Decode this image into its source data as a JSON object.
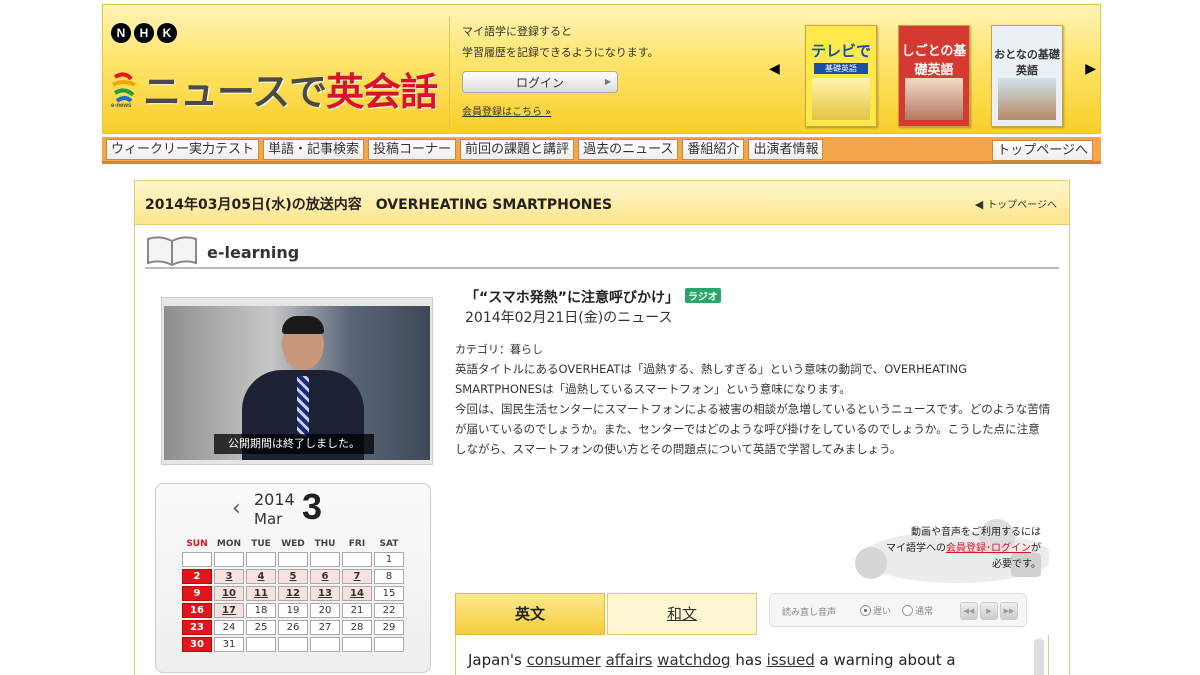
{
  "header": {
    "nhk_letters": [
      "N",
      "H",
      "K"
    ],
    "enews_caption": "e-news",
    "title_part1": "ニュースで",
    "title_part2": "英会話",
    "login_message_line1": "マイ語学に登録すると",
    "login_message_line2": "学習履歴を記録できるようになります。",
    "login_label": "ログイン",
    "register_label": "会員登録はこちら",
    "books": [
      {
        "title": "テレビで",
        "subtitle": "基礎英語",
        "color": "#ffe94a"
      },
      {
        "title": "しごとの基礎英語",
        "subtitle": "",
        "color": "#d43a32"
      },
      {
        "title": "おとなの基礎英語",
        "subtitle": "",
        "color": "#eaf0f4"
      }
    ]
  },
  "nav": {
    "items": [
      "ウィークリー実力テスト",
      "単語・記事検索",
      "投稿コーナー",
      "前回の課題と講評",
      "過去のニュース",
      "番組紹介",
      "出演者情報"
    ],
    "top_page": "トップページへ"
  },
  "broadcast": {
    "title": "2014年03月05日(水)の放送内容　OVERHEATING SMARTPHONES",
    "to_top": "トップページへ"
  },
  "elearning": {
    "label": "e-learning"
  },
  "video": {
    "caption": "公開期間は終了しました。"
  },
  "calendar": {
    "year": "2014",
    "month_name": "Mar",
    "month_num": "3",
    "weekdays": [
      "SUN",
      "MON",
      "TUE",
      "WED",
      "THU",
      "FRI",
      "SAT"
    ],
    "weeks": [
      [
        "",
        "",
        "",
        "",
        "",
        "",
        "1"
      ],
      [
        "2",
        "3",
        "4",
        "5",
        "6",
        "7",
        "8"
      ],
      [
        "9",
        "10",
        "11",
        "12",
        "13",
        "14",
        "15"
      ],
      [
        "16",
        "17",
        "18",
        "19",
        "20",
        "21",
        "22"
      ],
      [
        "23",
        "24",
        "25",
        "26",
        "27",
        "28",
        "29"
      ],
      [
        "30",
        "31",
        "",
        "",
        "",
        "",
        ""
      ]
    ],
    "available_days": [
      "3",
      "4",
      "5",
      "6",
      "7",
      "10",
      "11",
      "12",
      "13",
      "14",
      "17"
    ]
  },
  "article": {
    "title": "“スマホ発熱”に注意呼びかけ」",
    "badge": "ラジオ",
    "date": "2014年02月21日(金)のニュース",
    "category": "カテゴリ：暮らし",
    "body_paragraph1": "英語タイトルにあるOVERHEATは「過熱する、熱しすぎる」という意味の動詞で、OVERHEATING SMARTPHONESは「過熱しているスマートフォン」という意味になります。",
    "body_paragraph2": "今回は、国民生活センターにスマートフォンによる被害の相談が急増しているというニュースです。どのような苦情が届いているのでしょうか。また、センターではどのような呼び掛けをしているのでしょうか。こうした点に注意しながら、スマートフォンの使い方とその問題点について英語で学習してみましょう。"
  },
  "notice": {
    "line1": "動画や音声をご利用するには",
    "line2_prefix": "マイ語学への",
    "line2_link": "会員登録･ログイン",
    "line2_suffix": "が",
    "line3": "必要です。"
  },
  "tabs": {
    "english": "英文",
    "japanese": "和文"
  },
  "audio": {
    "label": "読み直し音声",
    "slow": "遅い",
    "normal": "通常"
  },
  "transcript": {
    "words": [
      "Japan's",
      "consumer",
      "affairs",
      "watchdog",
      "has",
      "issued",
      "a",
      "warning",
      "about",
      "a"
    ],
    "linked": [
      false,
      true,
      true,
      true,
      false,
      true,
      false,
      false,
      false,
      false
    ]
  }
}
